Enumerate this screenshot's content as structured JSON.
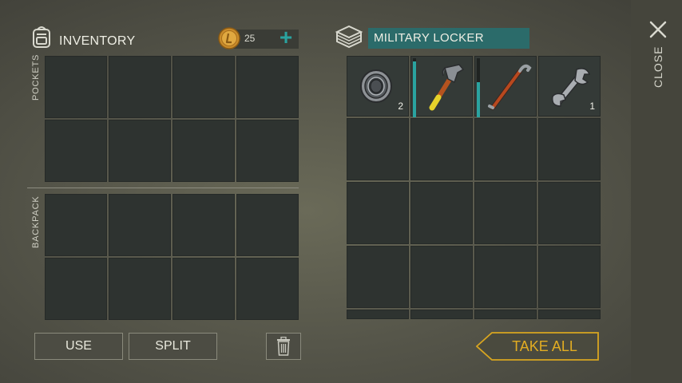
{
  "inventory": {
    "title": "INVENTORY",
    "coins": "25",
    "add_label": "+",
    "pockets_label": "POCKETS",
    "backpack_label": "BACKPACK"
  },
  "buttons": {
    "use": "USE",
    "split": "SPLIT"
  },
  "container": {
    "title": "MILITARY LOCKER",
    "take_all": "TAKE ALL",
    "items": [
      {
        "name": "bearing-icon",
        "qty": "2",
        "durability": null
      },
      {
        "name": "hammer-icon",
        "qty": "",
        "durability": 0.95
      },
      {
        "name": "crowbar-icon",
        "qty": "",
        "durability": 0.6
      },
      {
        "name": "wrench-icon",
        "qty": "1",
        "durability": null
      }
    ]
  },
  "side": {
    "close_label": "CLOSE"
  },
  "colors": {
    "accent_teal": "#2aa3a0",
    "take_all_gold": "#d8a520",
    "slot_bg": "#2e3330"
  }
}
